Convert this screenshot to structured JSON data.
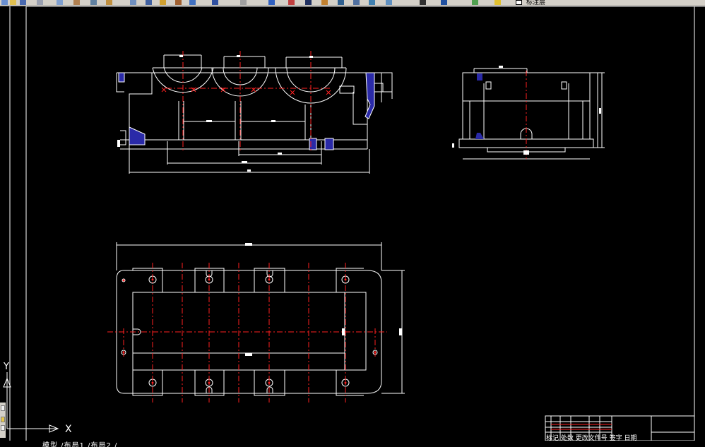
{
  "toolbar": {
    "icons": [
      "new-icon",
      "open-icon",
      "save-icon",
      "plot-icon",
      "preview-icon",
      "publish-icon",
      "cut-icon",
      "copy-icon",
      "paste-icon",
      "match-icon",
      "undo-icon",
      "redo-icon",
      "pan-icon",
      "zoom-icon",
      "zoom-window-icon",
      "zoom-previous-icon",
      "properties-icon",
      "design-center-icon",
      "tool-palette-icon",
      "sheet-set-icon",
      "markup-icon",
      "calc-icon",
      "help-icon",
      "layer-icon",
      "layer-state-icon"
    ],
    "layer_label": "标注层"
  },
  "ucs": {
    "x_label": "X",
    "y_label": "Y"
  },
  "status": {
    "tabs_text": "模型 /布局1 /布局2 /"
  },
  "title_block": {
    "row_text": "标记 处数 更改文件号 签字 日期"
  },
  "colors": {
    "background": "#000000",
    "outline": "#ffffff",
    "centerline": "#ff2020",
    "hatch": "#2a2aa8",
    "toolbar": "#d4d0c8"
  }
}
